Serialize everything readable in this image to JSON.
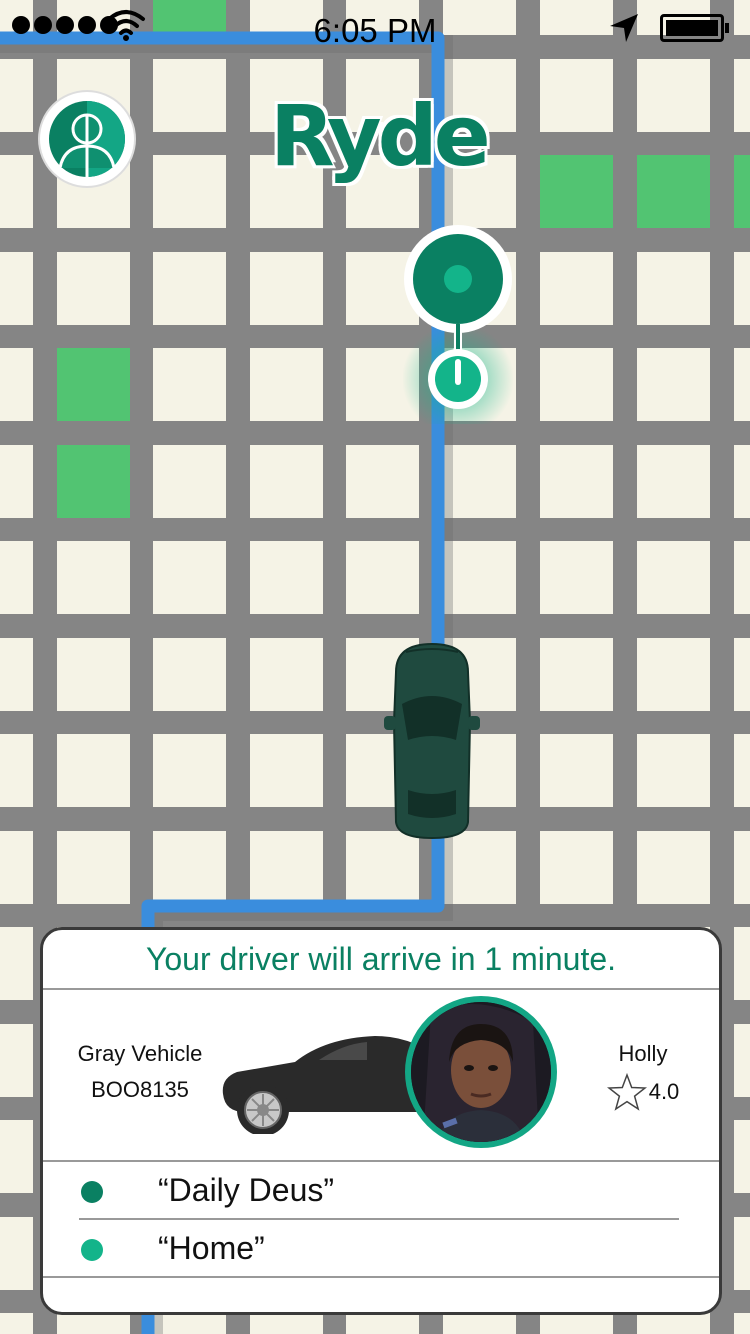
{
  "status_bar": {
    "time": "6:05 PM",
    "battery_level": 1.0
  },
  "app": {
    "logo_text": "Ryde",
    "brand_color": "#0a8062",
    "accent_color": "#13a685"
  },
  "map": {
    "road_color": "#858585",
    "block_color": "#f5f3e6",
    "park_color": "#52c472",
    "route_color": "#3a8ddd"
  },
  "trip_card": {
    "arrival_message": "Your driver will arrive in 1 minute.",
    "vehicle": {
      "description": "Gray Vehicle",
      "plate": "BOO8135"
    },
    "driver": {
      "name": "Holly",
      "rating": "4.0"
    },
    "destinations": [
      {
        "label": "“Daily Deus”",
        "dot_color": "#0a8062"
      },
      {
        "label": "“Home”",
        "dot_color": "#13b48a"
      }
    ]
  },
  "icons": [
    "signal-dots-icon",
    "wifi-icon",
    "location-arrow-icon",
    "battery-icon",
    "profile-icon",
    "pickup-pin-icon",
    "car-icon",
    "vehicle-silhouette-icon",
    "star-icon"
  ]
}
